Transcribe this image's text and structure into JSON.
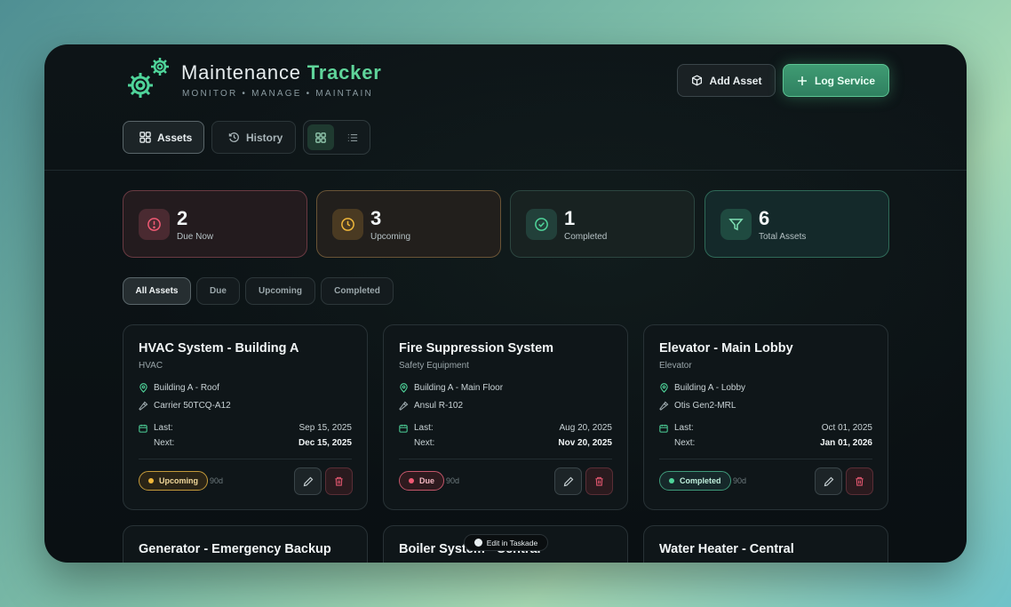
{
  "app": {
    "title_main": "Maintenance",
    "title_accent": "Tracker",
    "subtitle": "MONITOR • MANAGE • MAINTAIN",
    "logo_icon": "gears-icon",
    "accent_color": "#5fd49a"
  },
  "header": {
    "add_asset_label": "Add Asset",
    "log_service_label": "Log Service"
  },
  "nav": {
    "assets_label": "Assets",
    "history_label": "History",
    "view_toggle": {
      "selected": "grid",
      "options": [
        "grid",
        "list"
      ]
    }
  },
  "stats": [
    {
      "value": "2",
      "label": "Due Now",
      "icon": "alert-circle-icon",
      "color": "#f05a74"
    },
    {
      "value": "3",
      "label": "Upcoming",
      "icon": "clock-icon",
      "color": "#f0b73a"
    },
    {
      "value": "1",
      "label": "Completed",
      "icon": "check-circle-icon",
      "color": "#4fd49a"
    },
    {
      "value": "6",
      "label": "Total Assets",
      "icon": "filter-icon",
      "color": "#5fd49a"
    }
  ],
  "filters": {
    "selected": "All Assets",
    "items": [
      "All Assets",
      "Due",
      "Upcoming",
      "Completed"
    ]
  },
  "labels": {
    "last": "Last:",
    "next": "Next:"
  },
  "assets": [
    {
      "name": "HVAC System - Building A",
      "category": "HVAC",
      "location": "Building A - Roof",
      "model": "Carrier 50TCQ-A12",
      "last": "Sep 15, 2025",
      "next": "Dec 15, 2025",
      "status": "Upcoming",
      "interval": "90d"
    },
    {
      "name": "Fire Suppression System",
      "category": "Safety Equipment",
      "location": "Building A - Main Floor",
      "model": "Ansul R-102",
      "last": "Aug 20, 2025",
      "next": "Nov 20, 2025",
      "status": "Due",
      "interval": "90d"
    },
    {
      "name": "Elevator - Main Lobby",
      "category": "Elevator",
      "location": "Building A - Lobby",
      "model": "Otis Gen2-MRL",
      "last": "Oct 01, 2025",
      "next": "Jan 01, 2026",
      "status": "Completed",
      "interval": "90d"
    },
    {
      "name": "Generator - Emergency Backup"
    },
    {
      "name": "Boiler System - Central"
    },
    {
      "name": "Water Heater - Central"
    }
  ],
  "badge": {
    "label": "Edit in Taskade"
  }
}
